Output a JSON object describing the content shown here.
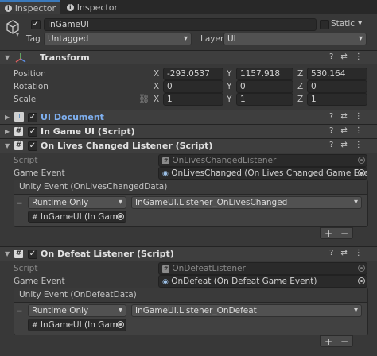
{
  "tabs": [
    {
      "label": "Inspector",
      "active": true
    },
    {
      "label": "Inspector",
      "active": false
    }
  ],
  "gameobject": {
    "name": "InGameUI",
    "static_label": "Static",
    "tag_label": "Tag",
    "tag_value": "Untagged",
    "layer_label": "Layer",
    "layer_value": "UI"
  },
  "transform": {
    "title": "Transform",
    "position_label": "Position",
    "rotation_label": "Rotation",
    "scale_label": "Scale",
    "x_label": "X",
    "y_label": "Y",
    "z_label": "Z",
    "position": {
      "x": "-293.0537",
      "y": "1157.918",
      "z": "530.164"
    },
    "rotation": {
      "x": "0",
      "y": "0",
      "z": "0"
    },
    "scale": {
      "x": "1",
      "y": "1",
      "z": "1"
    }
  },
  "components": {
    "ui_document": "UI Document",
    "in_game_ui": "In Game UI (Script)"
  },
  "lives_listener": {
    "title": "On Lives Changed Listener (Script)",
    "script_label": "Script",
    "script_value": "OnLivesChangedListener",
    "event_label": "Game Event",
    "event_value": "OnLivesChanged (On Lives Changed Game Event)",
    "unity_event_label": "Unity Event (OnLivesChangedData)",
    "runtime": "Runtime Only",
    "function": "InGameUI.Listener_OnLivesChanged",
    "target": "InGameUI (In Game U"
  },
  "defeat_listener": {
    "title": "On Defeat Listener (Script)",
    "script_label": "Script",
    "script_value": "OnDefeatListener",
    "event_label": "Game Event",
    "event_value": "OnDefeat (On Defeat Game Event)",
    "unity_event_label": "Unity Event (OnDefeatData)",
    "runtime": "Runtime Only",
    "function": "InGameUI.Listener_OnDefeat",
    "target": "InGameUI (In Game U"
  },
  "buttons": {
    "plus": "+",
    "minus": "−"
  },
  "colors": {
    "tab_accent": "#3a79bb",
    "ui_document_title": "#7fb0f0"
  }
}
